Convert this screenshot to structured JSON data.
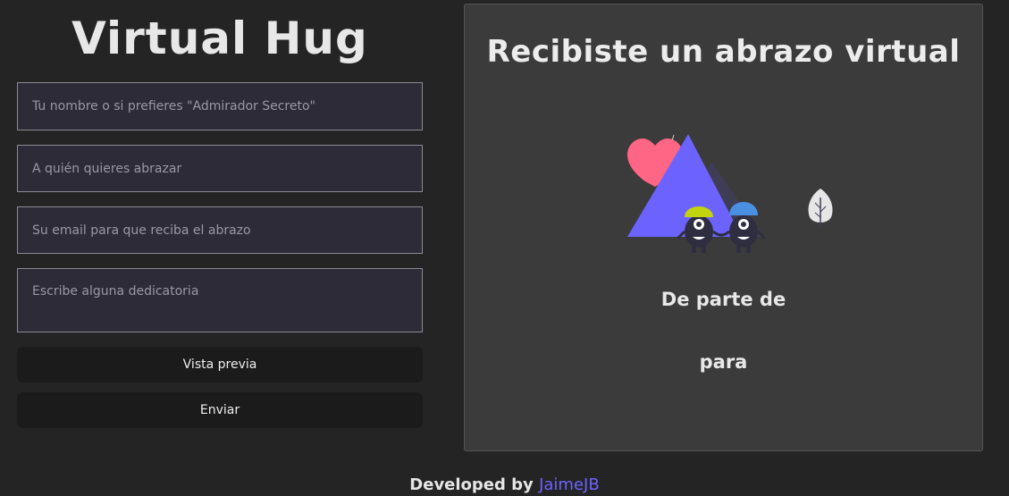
{
  "form": {
    "title": "Virtual Hug",
    "name_placeholder": "Tu nombre o si prefieres \"Admirador Secreto\"",
    "to_placeholder": "A quién quieres abrazar",
    "email_placeholder": "Su email para que reciba el abrazo",
    "message_placeholder": "Escribe alguna dedicatoria",
    "preview_label": "Vista previa",
    "send_label": "Enviar"
  },
  "preview": {
    "title": "Recibiste un abrazo virtual",
    "from_label": "De parte de",
    "to_label": "para"
  },
  "footer": {
    "prefix": "Developed by",
    "author": "JaimeJB"
  },
  "colors": {
    "accent": "#6c63ff",
    "heart": "#ff6584",
    "background": "#242424",
    "card": "#3b3b3b"
  }
}
